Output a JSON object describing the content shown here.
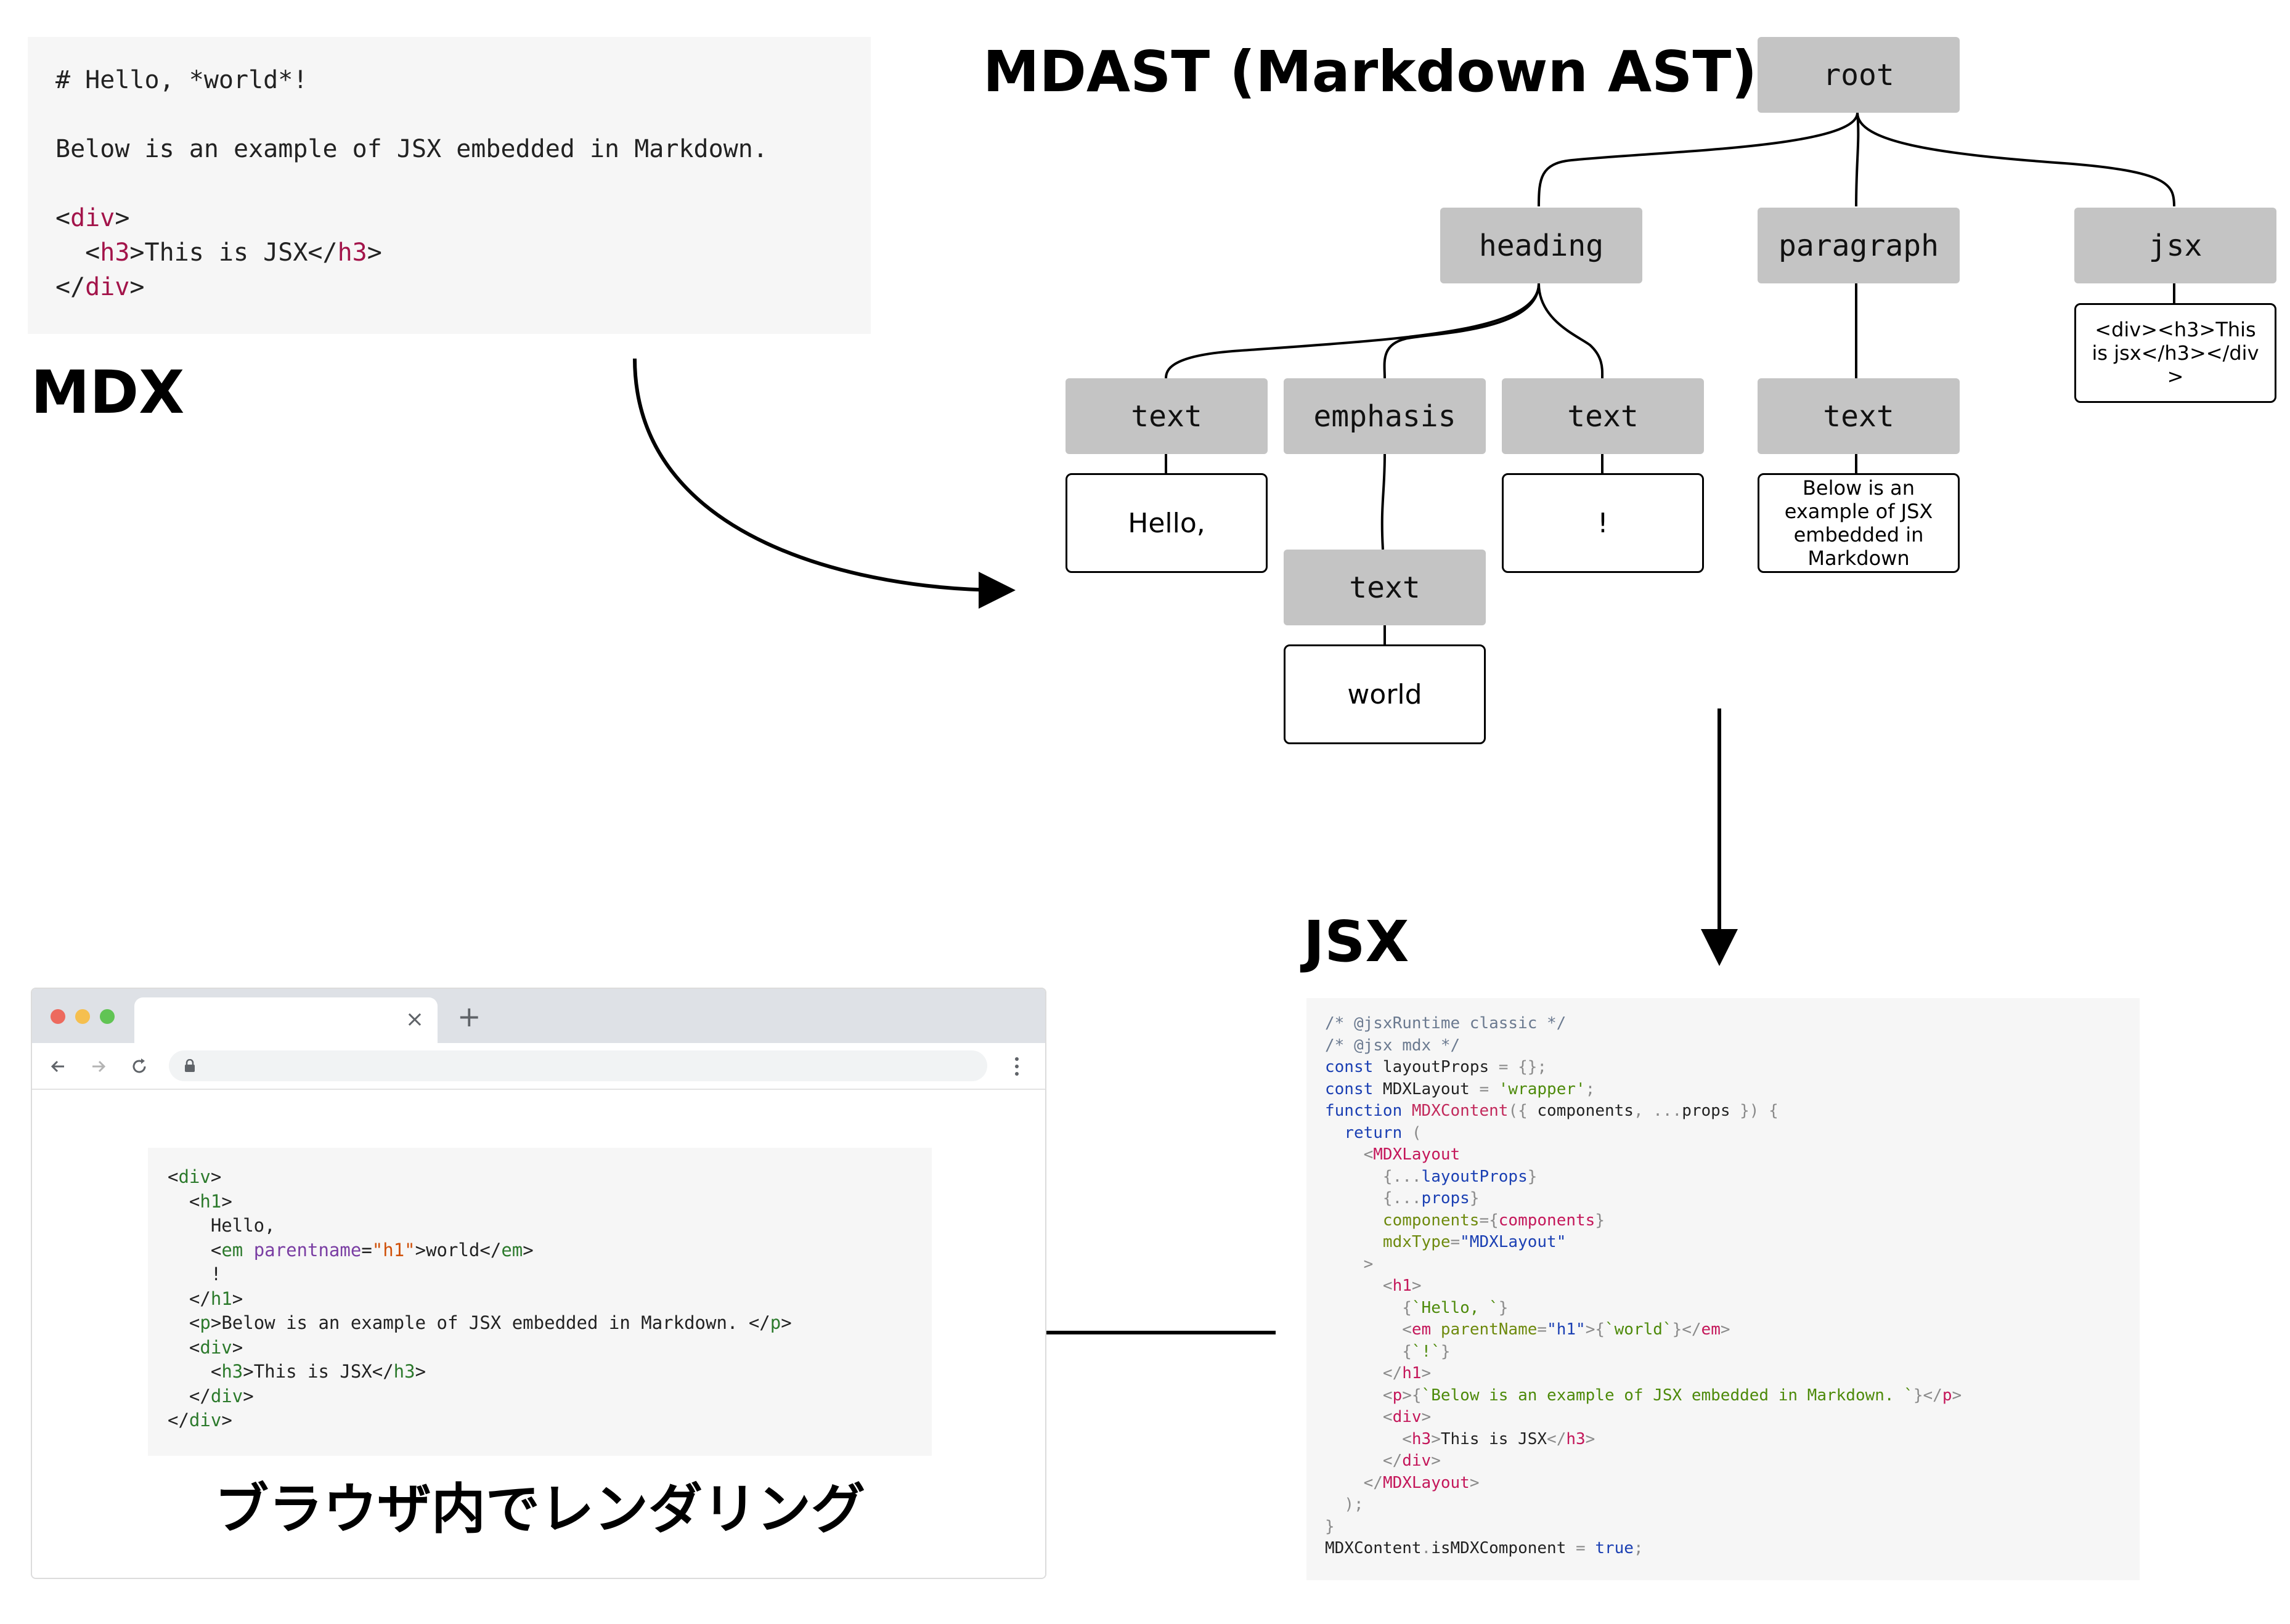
{
  "mdx": {
    "title": "MDX",
    "code_lines": [
      "# Hello, *world*!",
      "",
      "Below is an example of JSX embedded in Markdown.",
      "",
      "<div>",
      "  <h3>This is JSX</h3>",
      "</div>"
    ]
  },
  "mdast": {
    "title": "MDAST (Markdown AST)",
    "nodes": {
      "root": "root",
      "heading": "heading",
      "paragraph": "paragraph",
      "jsx": "jsx",
      "text1": "text",
      "emphasis": "emphasis",
      "text2": "text",
      "text3": "text",
      "text_em": "text"
    },
    "values": {
      "text1": "Hello,",
      "text2": "!",
      "text3": "Below is an example of JSX embedded in Markdown",
      "text_em": "world",
      "jsx": "<div><h3>This is jsx</h3></div>"
    }
  },
  "jsx": {
    "title": "JSX",
    "code_lines": [
      "/* @jsxRuntime classic */",
      "/* @jsx mdx */",
      "const layoutProps = {};",
      "const MDXLayout = 'wrapper';",
      "function MDXContent({ components, ...props }) {",
      "  return (",
      "    <MDXLayout",
      "      {...layoutProps}",
      "      {...props}",
      "      components={components}",
      "      mdxType=\"MDXLayout\"",
      "    >",
      "      <h1>",
      "        {`Hello, `}",
      "        <em parentName=\"h1\">{`world`}</em>",
      "        {`!`}",
      "      </h1>",
      "      <p>{`Below is an example of JSX embedded in Markdown. `}</p>",
      "      <div>",
      "        <h3>This is JSX</h3>",
      "      </div>",
      "    </MDXLayout>",
      "  );",
      "}",
      "MDXContent.isMDXComponent = true;"
    ]
  },
  "browser": {
    "tab_close": "×",
    "new_tab": "+",
    "caption": "ブラウザ内でレンダリング",
    "code_lines": [
      "<div>",
      "  <h1>",
      "    Hello,",
      "    <em parentname=\"h1\">world</em>",
      "    !",
      "  </h1>",
      "  <p>Below is an example of JSX embedded in Markdown. </p>",
      "  <div>",
      "    <h3>This is JSX</h3>",
      "  </div>",
      "</div>"
    ]
  },
  "colors": {
    "node_fill": "#c4c4c4",
    "panel_bg": "#f6f6f6",
    "tag": "#2c7a2c",
    "keyword": "#a3144a"
  }
}
